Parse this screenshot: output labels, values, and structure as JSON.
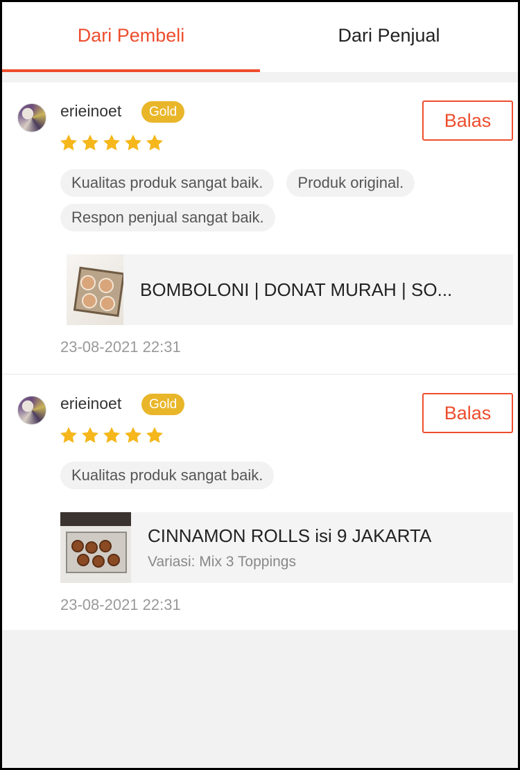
{
  "tabs": [
    {
      "label": "Dari Pembeli",
      "active": true
    },
    {
      "label": "Dari Penjual",
      "active": false
    }
  ],
  "colors": {
    "accent": "#ee4d2d",
    "gold_badge": "#e9b62a",
    "star": "#f5b71c"
  },
  "reviews": [
    {
      "username": "erieinoet",
      "badge": "Gold",
      "rating": 5,
      "reply_label": "Balas",
      "tags": [
        "Kualitas produk sangat baik.",
        "Produk original.",
        "Respon penjual sangat baik."
      ],
      "product_name": "BOMBOLONI | DONAT MURAH | SO...",
      "variation": "",
      "date": "23-08-2021 22:31"
    },
    {
      "username": "erieinoet",
      "badge": "Gold",
      "rating": 5,
      "reply_label": "Balas",
      "tags": [
        "Kualitas produk sangat baik."
      ],
      "product_name": "CINNAMON ROLLS isi 9 JAKARTA",
      "variation": "Variasi: Mix 3 Toppings",
      "date": "23-08-2021 22:31"
    }
  ]
}
